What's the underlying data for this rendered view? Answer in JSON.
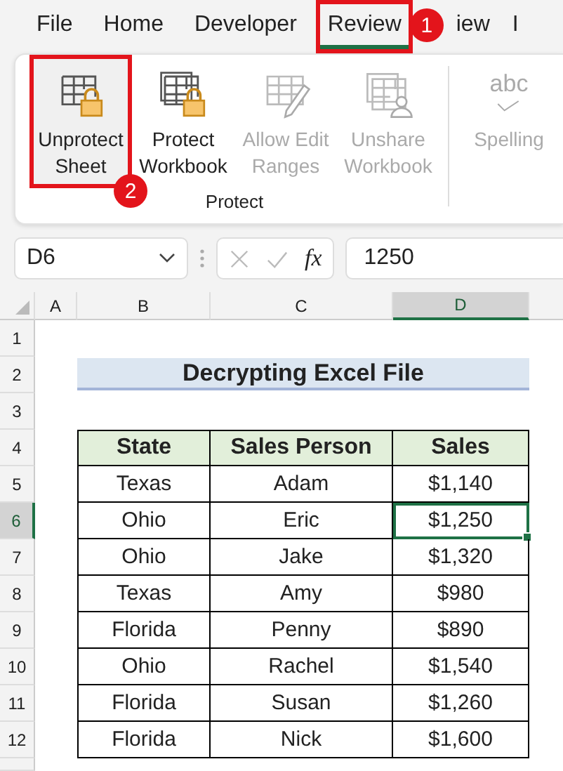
{
  "menu_tabs": [
    {
      "label": "File",
      "selected": false,
      "highlighted": false
    },
    {
      "label": "Home",
      "selected": false,
      "highlighted": false
    },
    {
      "label": "Developer",
      "selected": false,
      "highlighted": false
    },
    {
      "label": "Review",
      "selected": true,
      "highlighted": true,
      "callout": "1"
    },
    {
      "label": "iew",
      "selected": false,
      "highlighted": false
    },
    {
      "label": "I",
      "selected": false,
      "highlighted": false
    }
  ],
  "ribbon": {
    "groups": [
      {
        "label": "Protect",
        "buttons": [
          {
            "kind": "sheet-lock",
            "label": "Unprotect\nSheet",
            "disabled": false,
            "highlighted": true,
            "callout": "2"
          },
          {
            "kind": "workbook-lock",
            "label": "Protect\nWorkbook",
            "disabled": false,
            "highlighted": false
          },
          {
            "kind": "range-edit",
            "label": "Allow Edit\nRanges",
            "disabled": true,
            "highlighted": false
          },
          {
            "kind": "workbook-user",
            "label": "Unshare\nWorkbook",
            "disabled": true,
            "highlighted": false
          }
        ]
      },
      {
        "buttons": [
          {
            "kind": "spelling",
            "icon_text": "abc",
            "label": "Spelling",
            "disabled": true,
            "highlighted": false
          }
        ]
      }
    ]
  },
  "formula_bar": {
    "name_box": "D6",
    "fx": "fx",
    "formula": "1250"
  },
  "columns": [
    {
      "label": "A",
      "selected": false
    },
    {
      "label": "B",
      "selected": false
    },
    {
      "label": "C",
      "selected": false
    },
    {
      "label": "D",
      "selected": true
    }
  ],
  "row_headers": [
    {
      "label": "1",
      "selected": false
    },
    {
      "label": "2",
      "selected": false
    },
    {
      "label": "3",
      "selected": false
    },
    {
      "label": "4",
      "selected": false
    },
    {
      "label": "5",
      "selected": false
    },
    {
      "label": "6",
      "selected": true
    },
    {
      "label": "7",
      "selected": false
    },
    {
      "label": "8",
      "selected": false
    },
    {
      "label": "9",
      "selected": false
    },
    {
      "label": "10",
      "selected": false
    },
    {
      "label": "11",
      "selected": false
    },
    {
      "label": "12",
      "selected": false
    }
  ],
  "title": "Decrypting Excel File",
  "table": {
    "columns": [
      "State",
      "Sales Person",
      "Sales"
    ],
    "rows": [
      {
        "cells": [
          {
            "text": "Texas",
            "selected": false
          },
          {
            "text": "Adam",
            "selected": false
          },
          {
            "text": "$1,140",
            "selected": false
          }
        ]
      },
      {
        "cells": [
          {
            "text": "Ohio",
            "selected": false
          },
          {
            "text": "Eric",
            "selected": false
          },
          {
            "text": "$1,250",
            "selected": true
          }
        ]
      },
      {
        "cells": [
          {
            "text": "Ohio",
            "selected": false
          },
          {
            "text": "Jake",
            "selected": false
          },
          {
            "text": "$1,320",
            "selected": false
          }
        ]
      },
      {
        "cells": [
          {
            "text": "Texas",
            "selected": false
          },
          {
            "text": "Amy",
            "selected": false
          },
          {
            "text": "$980",
            "selected": false
          }
        ]
      },
      {
        "cells": [
          {
            "text": "Florida",
            "selected": false
          },
          {
            "text": "Penny",
            "selected": false
          },
          {
            "text": "$890",
            "selected": false
          }
        ]
      },
      {
        "cells": [
          {
            "text": "Ohio",
            "selected": false
          },
          {
            "text": "Rachel",
            "selected": false
          },
          {
            "text": "$1,540",
            "selected": false
          }
        ]
      },
      {
        "cells": [
          {
            "text": "Florida",
            "selected": false
          },
          {
            "text": "Susan",
            "selected": false
          },
          {
            "text": "$1,260",
            "selected": false
          }
        ]
      },
      {
        "cells": [
          {
            "text": "Florida",
            "selected": false
          },
          {
            "text": "Nick",
            "selected": false
          },
          {
            "text": "$1,600",
            "selected": false
          }
        ]
      }
    ]
  }
}
